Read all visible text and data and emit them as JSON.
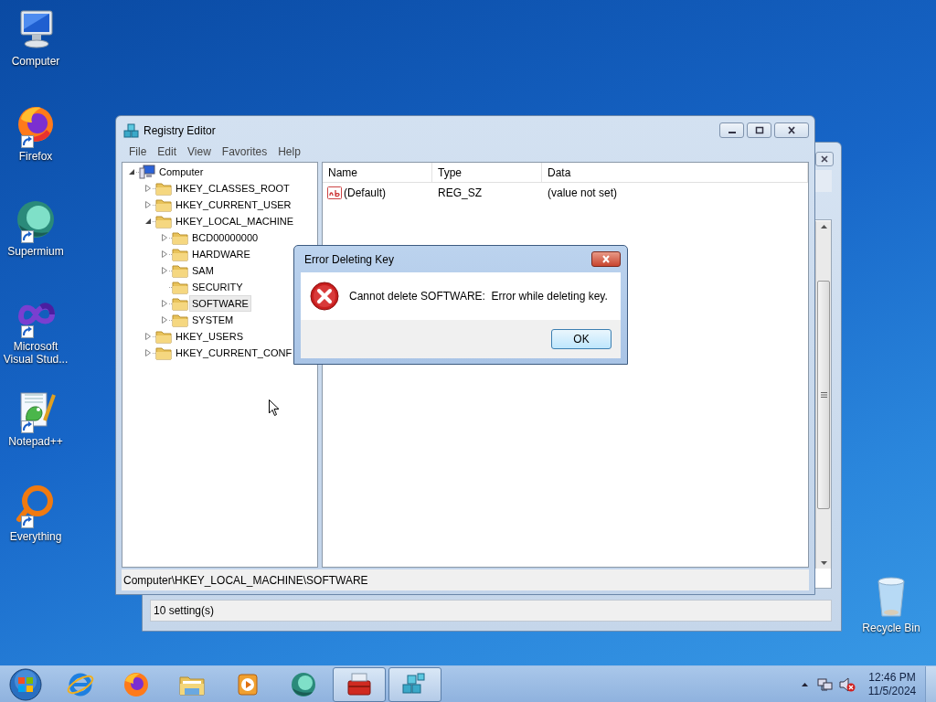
{
  "desktop_icons": [
    {
      "label": "Computer",
      "kind": "computer",
      "shortcut": false
    },
    {
      "label": "Firefox",
      "kind": "firefox",
      "shortcut": true
    },
    {
      "label": "Supermium",
      "kind": "supermium",
      "shortcut": true
    },
    {
      "label": "Microsoft Visual Stud...",
      "kind": "visual-studio",
      "shortcut": true
    },
    {
      "label": "Notepad++",
      "kind": "notepad",
      "shortcut": true
    },
    {
      "label": "Everything",
      "kind": "everything",
      "shortcut": true
    }
  ],
  "recycle_bin": {
    "label": "Recycle Bin"
  },
  "background_window": {
    "status_bar": "10 setting(s)"
  },
  "registry_editor": {
    "title": "Registry Editor",
    "menu": [
      "File",
      "Edit",
      "View",
      "Favorites",
      "Help"
    ],
    "tree": [
      {
        "label": "Computer",
        "kind": "computer",
        "expandable": true,
        "expanded": true,
        "selected": false,
        "children": [
          {
            "label": "HKEY_CLASSES_ROOT",
            "kind": "folder",
            "expandable": true,
            "expanded": false,
            "selected": false
          },
          {
            "label": "HKEY_CURRENT_USER",
            "kind": "folder",
            "expandable": true,
            "expanded": false,
            "selected": false
          },
          {
            "label": "HKEY_LOCAL_MACHINE",
            "kind": "folder",
            "expandable": true,
            "expanded": true,
            "selected": false,
            "children": [
              {
                "label": "BCD00000000",
                "kind": "folder",
                "expandable": true,
                "expanded": false,
                "selected": false
              },
              {
                "label": "HARDWARE",
                "kind": "folder",
                "expandable": true,
                "expanded": false,
                "selected": false
              },
              {
                "label": "SAM",
                "kind": "folder",
                "expandable": true,
                "expanded": false,
                "selected": false
              },
              {
                "label": "SECURITY",
                "kind": "folder",
                "expandable": false,
                "expanded": false,
                "selected": false
              },
              {
                "label": "SOFTWARE",
                "kind": "folder",
                "expandable": true,
                "expanded": false,
                "selected": true
              },
              {
                "label": "SYSTEM",
                "kind": "folder",
                "expandable": true,
                "expanded": false,
                "selected": false
              }
            ]
          },
          {
            "label": "HKEY_USERS",
            "kind": "folder",
            "expandable": true,
            "expanded": false,
            "selected": false
          },
          {
            "label": "HKEY_CURRENT_CONF",
            "kind": "folder",
            "expandable": true,
            "expanded": false,
            "selected": false
          }
        ]
      }
    ],
    "list": {
      "columns": [
        "Name",
        "Type",
        "Data"
      ],
      "rows": [
        {
          "name": "(Default)",
          "type": "REG_SZ",
          "data": "(value not set)"
        }
      ]
    },
    "status_bar": "Computer\\HKEY_LOCAL_MACHINE\\SOFTWARE"
  },
  "dialog": {
    "title": "Error Deleting Key",
    "message": "Cannot delete SOFTWARE:  Error while deleting key.",
    "buttons": [
      "OK"
    ]
  },
  "taskbar": {
    "items": [
      {
        "kind": "ie",
        "open": false
      },
      {
        "kind": "firefox",
        "open": false
      },
      {
        "kind": "explorer",
        "open": false
      },
      {
        "kind": "media",
        "open": false
      },
      {
        "kind": "supermium",
        "open": false
      },
      {
        "kind": "toolbox",
        "open": true
      },
      {
        "kind": "regedit",
        "open": true
      }
    ],
    "time": "12:46 PM",
    "date": "11/5/2024"
  }
}
